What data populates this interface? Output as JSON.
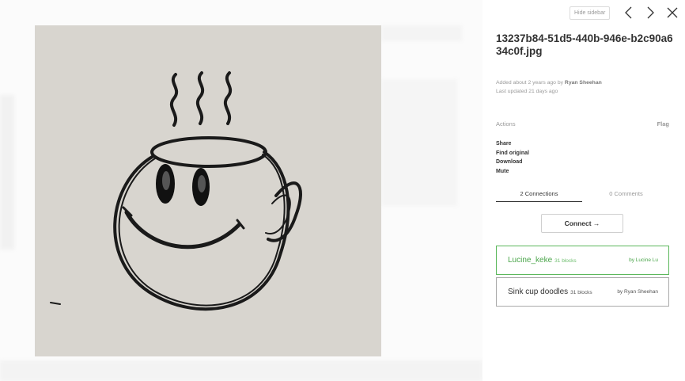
{
  "block": {
    "title": "13237b84-51d5-440b-946e-b2c90a634c0f.jpg",
    "added_prefix": "Added about 2 years ago by ",
    "added_by": "Ryan Sheehan",
    "last_updated": "Last updated 21 days ago",
    "image_alt": "cup doodle"
  },
  "toolbar": {
    "hide_sidebar_label": "Hide sidebar",
    "icons": [
      "chevron-left-icon",
      "chevron-right-icon",
      "close-icon"
    ]
  },
  "actions": {
    "header": "Actions",
    "flag": "Flag",
    "items": [
      "Share",
      "Find original",
      "Download",
      "Mute"
    ]
  },
  "tabs": [
    {
      "label": "2 Connections",
      "active": true
    },
    {
      "label": "0 Comments",
      "active": false
    }
  ],
  "connect_label": "Connect →",
  "channels": [
    {
      "name": "Lucine_keke",
      "blocks": "31 blocks",
      "by": "by Lucine Lu",
      "color": "#4aa54a"
    },
    {
      "name": "Sink cup doodles",
      "blocks": "31 blocks",
      "by": "by Ryan Sheehan",
      "color": "#333333"
    }
  ]
}
